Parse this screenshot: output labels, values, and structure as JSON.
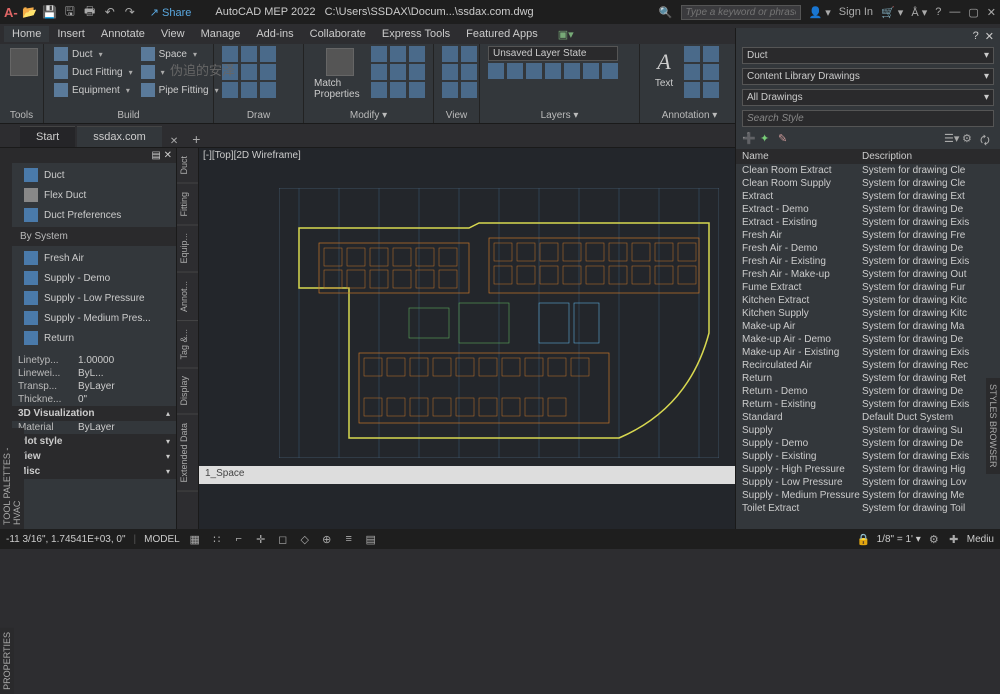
{
  "app": {
    "title": "AutoCAD MEP 2022",
    "doc_path": "C:\\Users\\SSDAX\\Docum...\\ssdax.com.dwg"
  },
  "topbar": {
    "share": "Share",
    "search_placeholder": "Type a keyword or phrase",
    "signin": "Sign In"
  },
  "menus": [
    "Home",
    "Insert",
    "Annotate",
    "View",
    "Manage",
    "Add-ins",
    "Collaborate",
    "Express Tools",
    "Featured Apps"
  ],
  "ribbon": {
    "tools": "Tools",
    "build": {
      "label": "Build",
      "items": [
        "Duct",
        "Space",
        "Duct Fitting",
        "",
        "Equipment",
        "Pipe Fitting"
      ]
    },
    "draw": "Draw",
    "modify": {
      "label": "Modify ▾",
      "match": "Match Properties"
    },
    "view": "View",
    "layers": {
      "label": "Layers ▾",
      "state": "Unsaved Layer State"
    },
    "annotation": {
      "label": "Annotation ▾",
      "text": "Text"
    }
  },
  "watermark": {
    "cn": "伪追的安泽"
  },
  "tabs": {
    "start": "Start",
    "file": "ssdax.com"
  },
  "viewport_label": "[-][Top][2D Wireframe]",
  "palette": {
    "hvac_title": "TOOL PALETTES - HVAC",
    "items1": [
      "Duct",
      "Flex Duct",
      "Duct Preferences"
    ],
    "by_system": "By System",
    "items2": [
      "Fresh Air",
      "Supply - Demo",
      "Supply - Low Pressure",
      "Supply -  Medium Pres...",
      "Return"
    ],
    "side_tabs": [
      "Duct",
      "Fitting",
      "Equip...",
      "Annot...",
      "Tag &...",
      "Display",
      "Extended Data"
    ]
  },
  "props": {
    "title": "PROPERTIES",
    "rows": [
      [
        "Linetyp...",
        "1.00000"
      ],
      [
        "Linewei...",
        "ByL..."
      ],
      [
        "Transp...",
        "ByLayer"
      ],
      [
        "Thickne...",
        "0\""
      ]
    ],
    "vis": "3D Visualization",
    "vis_rows": [
      [
        "Material",
        "ByLayer"
      ]
    ],
    "groups": [
      "Plot style",
      "View",
      "Misc"
    ]
  },
  "space_bar": "1_Space",
  "right_panel": {
    "dd1": "Duct",
    "dd2": "Content Library Drawings",
    "dd3": "All Drawings",
    "search": "Search Style",
    "col1": "Name",
    "col2": "Description",
    "vtab": "STYLES BROWSER",
    "rows": [
      [
        "Clean Room Extract",
        "System for drawing Cle"
      ],
      [
        "Clean Room Supply",
        "System for drawing Cle"
      ],
      [
        "Extract",
        "System for drawing Ext"
      ],
      [
        "Extract - Demo",
        "System for drawing De"
      ],
      [
        "Extract - Existing",
        "System for drawing Exis"
      ],
      [
        "Fresh Air",
        "System for drawing Fre"
      ],
      [
        "Fresh Air - Demo",
        "System for drawing De"
      ],
      [
        "Fresh Air - Existing",
        "System for drawing Exis"
      ],
      [
        "Fresh Air - Make-up",
        "System for drawing Out"
      ],
      [
        "Fume Extract",
        "System for drawing Fur"
      ],
      [
        "Kitchen Extract",
        "System for drawing Kitc"
      ],
      [
        "Kitchen Supply",
        "System for drawing Kitc"
      ],
      [
        "Make-up Air",
        "System for drawing Ma"
      ],
      [
        "Make-up Air - Demo",
        "System for drawing De"
      ],
      [
        "Make-up Air - Existing",
        "System for drawing Exis"
      ],
      [
        "Recirculated Air",
        "System for drawing Rec"
      ],
      [
        "Return",
        "System for drawing Ret"
      ],
      [
        "Return - Demo",
        "System for drawing De"
      ],
      [
        "Return - Existing",
        "System for drawing Exis"
      ],
      [
        "Standard",
        "Default Duct System"
      ],
      [
        "Supply",
        "System for drawing Su"
      ],
      [
        "Supply - Demo",
        "System for drawing De"
      ],
      [
        "Supply - Existing",
        "System for drawing Exis"
      ],
      [
        "Supply - High Pressure",
        "System for drawing Hig"
      ],
      [
        "Supply - Low Pressure",
        "System for drawing Lov"
      ],
      [
        "Supply - Medium Pressure",
        "System for drawing Me"
      ],
      [
        "Toilet Extract",
        "System for drawing Toil"
      ]
    ]
  },
  "status": {
    "coords": "-11 3/16\", 1.74541E+03, 0\"",
    "model": "MODEL",
    "scale": "1/8\" = 1'",
    "annot": "Mediu"
  }
}
